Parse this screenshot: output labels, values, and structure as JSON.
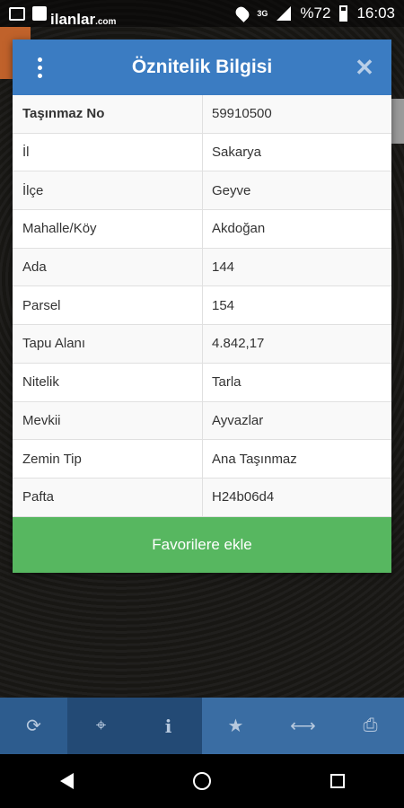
{
  "status": {
    "brand": "ilanlar",
    "brand_suffix": ".com",
    "network": "3G",
    "battery": "%72",
    "time": "16:03"
  },
  "dialog": {
    "title": "Öznitelik Bilgisi",
    "rows": [
      {
        "key": "Taşınmaz No",
        "value": "59910500"
      },
      {
        "key": "İl",
        "value": "Sakarya"
      },
      {
        "key": "İlçe",
        "value": "Geyve"
      },
      {
        "key": "Mahalle/Köy",
        "value": "Akdoğan"
      },
      {
        "key": "Ada",
        "value": "144"
      },
      {
        "key": "Parsel",
        "value": "154"
      },
      {
        "key": "Tapu Alanı",
        "value": "4.842,17"
      },
      {
        "key": "Nitelik",
        "value": "Tarla"
      },
      {
        "key": "Mevkii",
        "value": "Ayvazlar"
      },
      {
        "key": "Zemin Tip",
        "value": "Ana Taşınmaz"
      },
      {
        "key": "Pafta",
        "value": "H24b06d4"
      }
    ],
    "favorite_label": "Favorilere ekle"
  },
  "toolbar": {
    "items": [
      "refresh-icon",
      "crosshair-icon",
      "info-icon",
      "star-icon",
      "measure-icon",
      "print-icon"
    ]
  }
}
